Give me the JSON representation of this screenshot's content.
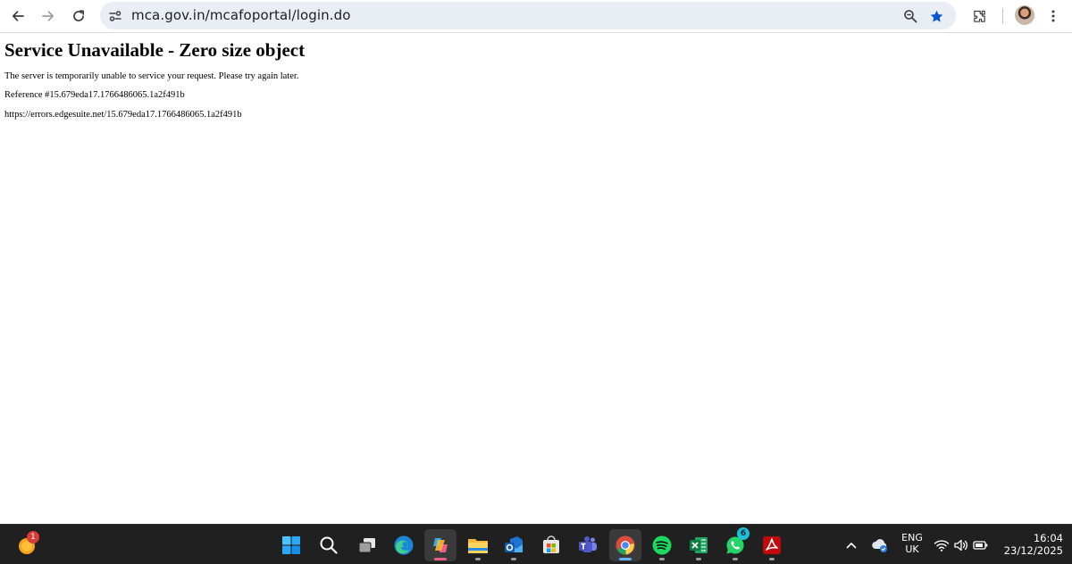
{
  "browser": {
    "url": "mca.gov.in/mcafoportal/login.do",
    "colors": {
      "toolbar_bg": "#ffffff",
      "omnibox_bg": "#e9edf4",
      "bookmark_star": "#0b57d0"
    },
    "icons": [
      "back-arrow-icon",
      "forward-arrow-icon",
      "reload-icon",
      "site-info-icon",
      "zoom-icon",
      "bookmark-star-icon",
      "extensions-icon",
      "more-vert-icon"
    ]
  },
  "page": {
    "title": "Service Unavailable - Zero size object",
    "message": "The server is temporarily unable to service your request. Please try again later.",
    "reference": "Reference #15.679eda17.1766486065.1a2f491b",
    "error_url": "https://errors.edgesuite.net/15.679eda17.1766486065.1a2f491b"
  },
  "taskbar": {
    "weather_badge": "1",
    "whatsapp_badge": "6",
    "language_top": "ENG",
    "language_bottom": "UK",
    "time": "16:04",
    "date": "23/12/2025",
    "apps": [
      "start",
      "search",
      "task-view",
      "edge",
      "copilot",
      "file-explorer",
      "outlook",
      "microsoft-store",
      "teams",
      "chrome",
      "spotify",
      "excel",
      "whatsapp",
      "acrobat"
    ]
  }
}
